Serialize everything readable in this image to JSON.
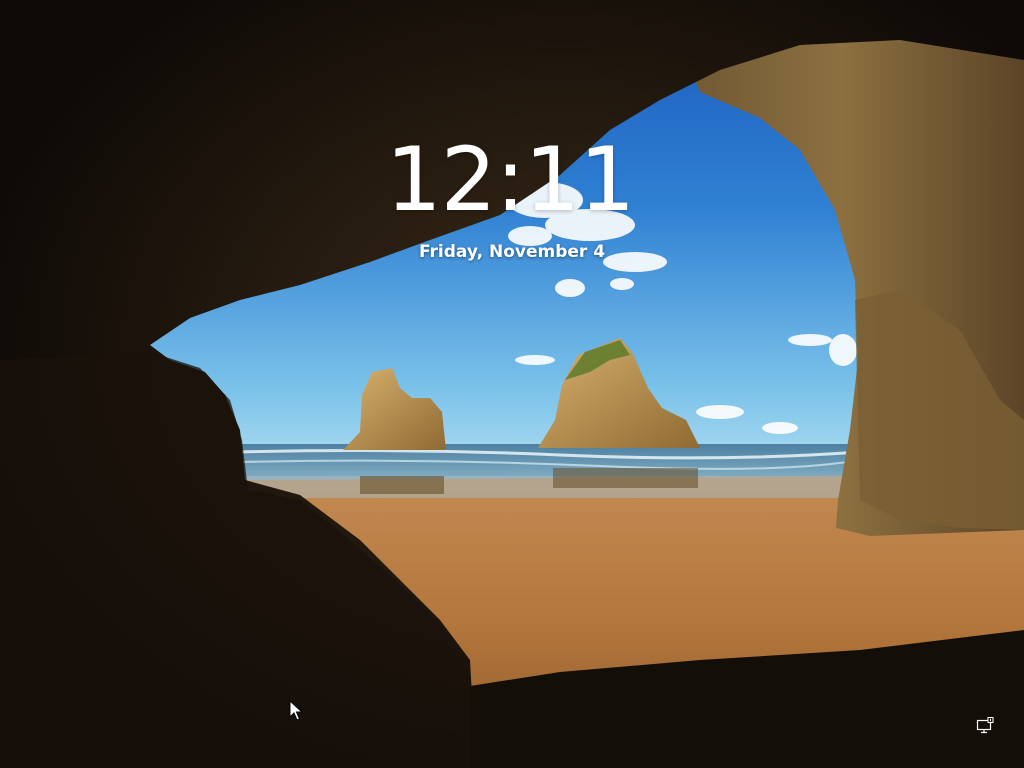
{
  "lock_screen": {
    "time": "12:11",
    "date": "Friday, November 4"
  },
  "status_icons": {
    "network": "network-computer-icon"
  },
  "pointer": "mouse-cursor-icon",
  "colors": {
    "text": "#ffffff",
    "sky_top": "#1f63c4",
    "sky_bottom": "#7cc3ea",
    "sand": "#b87a3e",
    "cave": "#0d0906"
  }
}
